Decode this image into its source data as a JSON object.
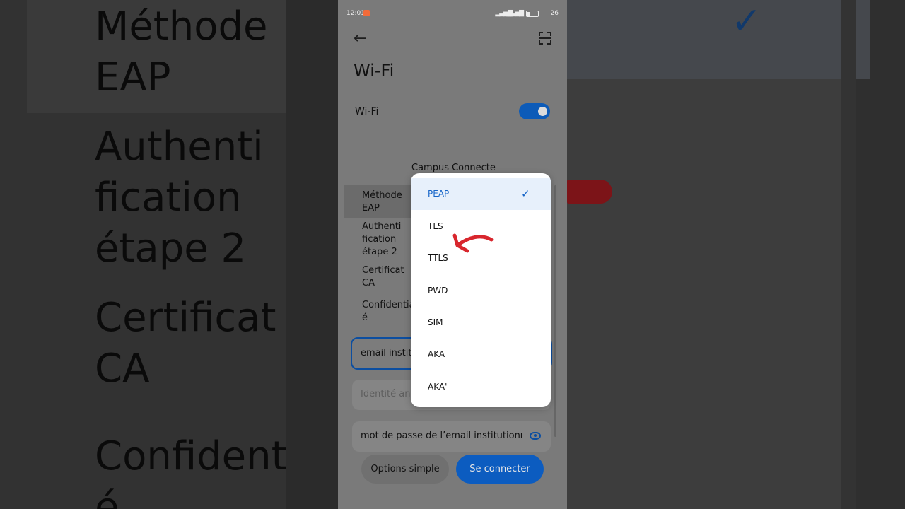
{
  "background": {
    "left_text": "Méthode\nEAP\n\nAuthenti\nfication\nétape 2\n\nCertificat\nCA\n\nConfidentia\né"
  },
  "status_bar": {
    "time": "12:01",
    "signal_1": "▂▃▅▇",
    "signal_2": "▂▃▅▇",
    "battery": "26"
  },
  "header": {
    "back_icon": "←",
    "title": "Wi-Fi"
  },
  "wifi_toggle": {
    "label": "Wi-Fi",
    "enabled": true
  },
  "dialog": {
    "title": "Campus Connecte",
    "fields": [
      {
        "label": "Méthode EAP"
      },
      {
        "label": "Authenti fication étape 2"
      },
      {
        "label": "Certificat CA"
      },
      {
        "label": "Confidentiali é"
      }
    ],
    "identity_value": "email institu",
    "anonymous_placeholder": "Identité an",
    "password_value": "mot de passe de l’email institutionn",
    "buttons": {
      "simple": "Options simple",
      "connect": "Se connecter"
    }
  },
  "dropdown": {
    "options": [
      "PEAP",
      "TLS",
      "TTLS",
      "PWD",
      "SIM",
      "AKA",
      "AKA'"
    ],
    "selected": "PEAP",
    "check_icon": "✓"
  },
  "colors": {
    "accent": "#0c5cc0",
    "annotation_red": "#d8262d"
  }
}
